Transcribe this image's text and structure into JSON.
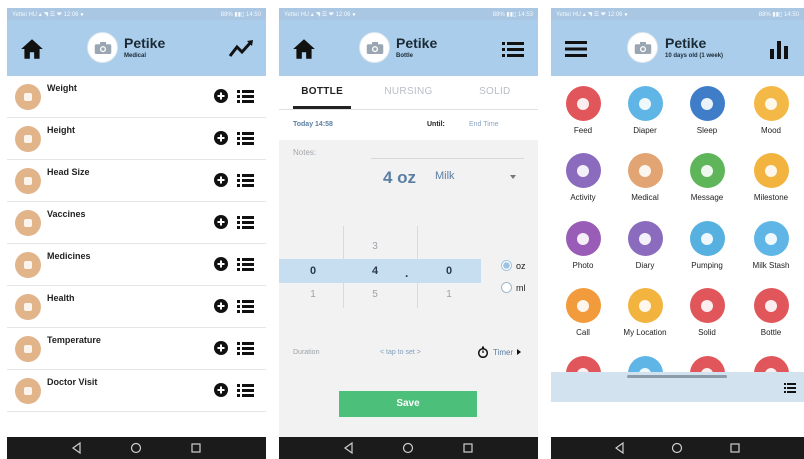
{
  "app_name": "Petike",
  "screens": [
    {
      "status_left": "Yettel HU ▴ ◥ ☰ ❤ 12:06 ●",
      "status_right": "88% ▮▮▯ 14:50",
      "title": "Petike",
      "subtitle": "Medical",
      "left_icon": "home-icon",
      "right_icon": "trend-chart-icon",
      "items": [
        {
          "label": "Weight",
          "icon": "scale-icon"
        },
        {
          "label": "Height",
          "icon": "ruler-icon"
        },
        {
          "label": "Head Size",
          "icon": "head-size-icon"
        },
        {
          "label": "Vaccines",
          "icon": "syringe-icon"
        },
        {
          "label": "Medicines",
          "icon": "medicine-bottle-icon"
        },
        {
          "label": "Health",
          "icon": "stethoscope-icon"
        },
        {
          "label": "Temperature",
          "icon": "thermometer-icon"
        },
        {
          "label": "Doctor Visit",
          "icon": "doctor-bag-icon"
        }
      ]
    },
    {
      "status_left": "Yettel HU ▴ ◥ ☰ ❤ 12:06 ●",
      "status_right": "88% ▮▮▯ 14:53",
      "title": "Petike",
      "subtitle": "Bottle",
      "left_icon": "home-icon",
      "right_icon": "list-icon",
      "tabs": [
        "BOTTLE",
        "NURSING",
        "SOLID"
      ],
      "active_tab": "BOTTLE",
      "start_time": "Today 14:58",
      "until_label": "Until:",
      "end_time": "End Time",
      "notes_label": "Notes:",
      "amount": "4 oz",
      "amount_kind": "Milk",
      "picker": {
        "col1": [
          "",
          "0",
          "1"
        ],
        "col2": [
          "3",
          "4",
          "5"
        ],
        "col3": [
          "",
          "0",
          "1"
        ],
        "separator": "."
      },
      "units": [
        {
          "label": "oz",
          "selected": true
        },
        {
          "label": "ml",
          "selected": false
        }
      ],
      "duration_label": "Duration",
      "duration_value": "< tap to set >",
      "timer_label": "Timer",
      "save_label": "Save",
      "colors": {
        "accent": "#5a7ea3",
        "save": "#4cc07b",
        "picker_band": "#c7def1"
      }
    },
    {
      "status_left": "Yettel HU ▴ ◥ ☰ ❤ 12:06 ●",
      "status_right": "88% ▮▮▯ 14:50",
      "title": "Petike",
      "subtitle": "10 days old (1 week)",
      "left_icon": "hamburger-menu-icon",
      "right_icon": "bar-chart-icon",
      "tiles": [
        {
          "label": "Feed",
          "color": "#e0565b",
          "icon": "feed-icon"
        },
        {
          "label": "Diaper",
          "color": "#5fb6e6",
          "icon": "diaper-icon"
        },
        {
          "label": "Sleep",
          "color": "#3f7dc9",
          "icon": "moon-icon"
        },
        {
          "label": "Mood",
          "color": "#f4b846",
          "icon": "smiley-icon"
        },
        {
          "label": "Activity",
          "color": "#8a6bbd",
          "icon": "abc-blocks-icon"
        },
        {
          "label": "Medical",
          "color": "#e2a473",
          "icon": "doctor-icon"
        },
        {
          "label": "Message",
          "color": "#5fb65a",
          "icon": "chat-bubble-icon"
        },
        {
          "label": "Milestone",
          "color": "#f2b43e",
          "icon": "star-icon"
        },
        {
          "label": "Photo",
          "color": "#9a5db7",
          "icon": "camera-icon"
        },
        {
          "label": "Diary",
          "color": "#8a6bbd",
          "icon": "notebook-icon"
        },
        {
          "label": "Pumping",
          "color": "#56b0e0",
          "icon": "breast-pump-icon"
        },
        {
          "label": "Milk Stash",
          "color": "#5fb6e6",
          "icon": "milk-bottle-icon"
        },
        {
          "label": "Call",
          "color": "#f19b3c",
          "icon": "phone-icon"
        },
        {
          "label": "My Location",
          "color": "#f2b43e",
          "icon": "location-pin-icon"
        },
        {
          "label": "Solid",
          "color": "#e0565b",
          "icon": "bowl-icon"
        },
        {
          "label": "Bottle",
          "color": "#e0565b",
          "icon": "baby-bottle-icon"
        },
        {
          "label": "",
          "color": "#e0565b",
          "icon": "partial-icon"
        },
        {
          "label": "",
          "color": "#5fb6e6",
          "icon": "partial-icon"
        },
        {
          "label": "",
          "color": "#e0565b",
          "icon": "partial-icon"
        },
        {
          "label": "",
          "color": "#e0565b",
          "icon": "partial-icon"
        }
      ]
    }
  ]
}
